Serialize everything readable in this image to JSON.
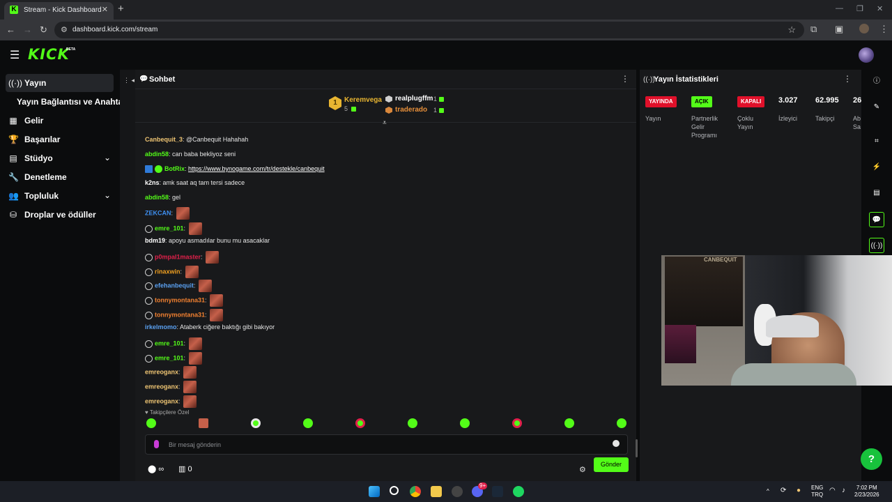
{
  "browser": {
    "tab_title": "Stream - Kick Dashboard",
    "url": "dashboard.kick.com/stream",
    "favicon": "K"
  },
  "brand": {
    "logo": "KICK",
    "beta": "BETA",
    "accent": "#53fc18"
  },
  "sidebar": {
    "items": [
      {
        "label": "Yayın",
        "icon": "broadcast-icon"
      },
      {
        "label": "Yayın Bağlantısı ve Anahtarı",
        "icon": ""
      },
      {
        "label": "Gelir",
        "icon": "revenue-icon"
      },
      {
        "label": "Başarılar",
        "icon": "trophy-icon"
      },
      {
        "label": "Stüdyo",
        "icon": "studio-icon"
      },
      {
        "label": "Denetleme",
        "icon": "wrench-icon"
      },
      {
        "label": "Topluluk",
        "icon": "community-icon"
      },
      {
        "label": "Droplar ve ödüller",
        "icon": "drops-icon"
      }
    ]
  },
  "chat": {
    "title": "Sohbet",
    "leaderboard": {
      "top": {
        "rank": "1",
        "name": "Keremvega",
        "count": "5"
      },
      "others": [
        {
          "name": "realplugffm",
          "count": "1"
        },
        {
          "name": "traderado",
          "count": "1"
        }
      ]
    },
    "messages": [
      {
        "user": "Canbequit_3",
        "color": "#f0c674",
        "text": "@Canbequit Hahahah",
        "emote": false
      },
      {
        "user": "abdin58",
        "color": "#53fc18",
        "text": "can baba bekliyoz seni",
        "emote": false
      },
      {
        "user": "BotRix",
        "color": "#53fc18",
        "text": "",
        "link": "https://www.bynogame.com/tr/destekle/canbequit",
        "emote": false,
        "badge": true
      },
      {
        "user": "k2ns",
        "color": "#ffffff",
        "text": "amk saat aq tam tersi sadece",
        "emote": false
      },
      {
        "user": "abdin58",
        "color": "#53fc18",
        "text": "gel",
        "emote": false
      },
      {
        "user": "ZEKCAN",
        "color": "#3e8ff0",
        "text": "",
        "emote": true
      },
      {
        "user": "emre_101",
        "color": "#53fc18",
        "text": "",
        "emote": true,
        "badge": true
      },
      {
        "user": "bdm19",
        "color": "#ffffff",
        "text": "apoyu asmadılar bunu mu asacaklar",
        "emote": false
      },
      {
        "user": "p0mpal1master",
        "color": "#e0204a",
        "text": "",
        "emote": true,
        "badge": true
      },
      {
        "user": "rinaxwin",
        "color": "#f0a020",
        "text": "",
        "emote": true,
        "badge": true
      },
      {
        "user": "efehanbequit",
        "color": "#5aa0f0",
        "text": "",
        "emote": true,
        "badge": true
      },
      {
        "user": "tonnymontana31",
        "color": "#f08030",
        "text": "",
        "emote": true,
        "badge": true
      },
      {
        "user": "tonnymontana31",
        "color": "#f08030",
        "text": "",
        "emote": true,
        "badge": true
      },
      {
        "user": "irkelmomo",
        "color": "#5aa0f0",
        "text": "Ataberk ciğere baktığı gibi bakıyor",
        "emote": false
      },
      {
        "user": "emre_101",
        "color": "#53fc18",
        "text": "",
        "emote": true,
        "badge": true
      },
      {
        "user": "emre_101",
        "color": "#53fc18",
        "text": "",
        "emote": true,
        "badge": true
      },
      {
        "user": "emreoganx",
        "color": "#f0c674",
        "text": "",
        "emote": true
      },
      {
        "user": "emreoganx",
        "color": "#f0c674",
        "text": "",
        "emote": true
      },
      {
        "user": "emreoganx",
        "color": "#f0c674",
        "text": "",
        "emote": true
      }
    ],
    "followers_only": "♥ Takipçilere Özel",
    "input_placeholder": "Bir mesaj gönderin",
    "points": "∞",
    "store_count": "0",
    "send_label": "Gönder"
  },
  "stats": {
    "title": "Yayın İstatistikleri",
    "pills": [
      {
        "label": "YAYINDA",
        "desc": "Yayın",
        "bg": "#e0102a",
        "fg": "#ffffff"
      },
      {
        "label": "AÇIK",
        "desc": "Partnerlik Gelir Programı",
        "bg": "#53fc18",
        "fg": "#000000"
      },
      {
        "label": "KAPALI",
        "desc": "Çoklu Yayın",
        "bg": "#e0102a",
        "fg": "#ffffff"
      }
    ],
    "numbers": [
      {
        "value": "3.027",
        "label": "İzleyici"
      },
      {
        "value": "62.995",
        "label": "Takipçi"
      },
      {
        "value": "26",
        "label": "Ab Sa"
      }
    ]
  },
  "webcam": {
    "poster_text": "CANBEQUIT"
  },
  "taskbar": {
    "lang": "ENG",
    "region": "TRQ",
    "time": "7:02 PM",
    "date": "2/23/2026",
    "discord_badge": "9+"
  }
}
